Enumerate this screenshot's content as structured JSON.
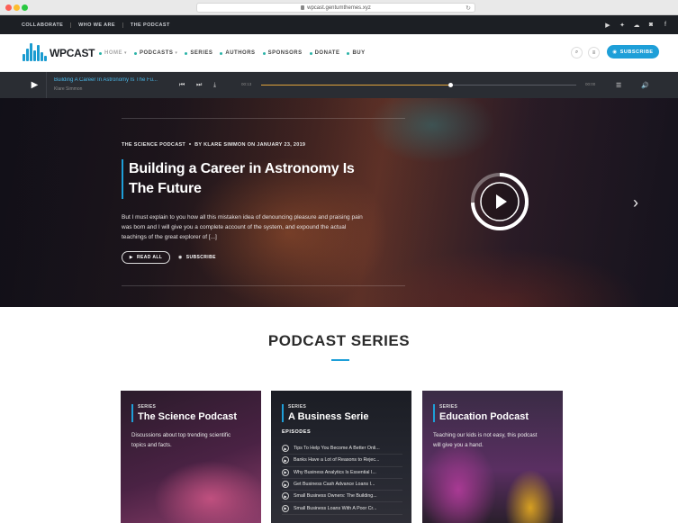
{
  "browser": {
    "url": "wpcast.gentumthemes.xyz"
  },
  "topbar": {
    "links": [
      "COLLABORATE",
      "WHO WE ARE",
      "THE PODCAST"
    ],
    "social_icons": [
      "youtube-icon",
      "twitter-icon",
      "soundcloud-icon",
      "instagram-icon",
      "facebook-icon"
    ]
  },
  "header": {
    "logo_text": "WPCAST",
    "nav": [
      {
        "label": "HOME",
        "active": true,
        "dropdown": true
      },
      {
        "label": "PODCASTS",
        "active": false,
        "dropdown": true
      },
      {
        "label": "SERIES",
        "active": false,
        "dropdown": false
      },
      {
        "label": "AUTHORS",
        "active": false,
        "dropdown": false
      },
      {
        "label": "SPONSORS",
        "active": false,
        "dropdown": false
      },
      {
        "label": "DONATE",
        "active": false,
        "dropdown": false
      },
      {
        "label": "BUY",
        "active": false,
        "dropdown": false
      }
    ],
    "subscribe_label": "SUBSCRIBE"
  },
  "player": {
    "title": "Building A Career In Astronomy Is The Fu...",
    "author": "Klare Simmon",
    "time_current": "00:13",
    "time_total": "00:00",
    "progress": 0.6
  },
  "hero": {
    "category": "THE SCIENCE PODCAST",
    "byline": "BY KLARE SIMMON ON JANUARY 23, 2019",
    "title_line1": "Building a Career in Astronomy Is",
    "title_line2": "The Future",
    "excerpt": "But I must explain to you how all this mistaken idea of denouncing pleasure and praising pain was born and I will give you a complete account of the system, and expound the actual teachings of the great explorer of [...]",
    "read_more": "READ ALL",
    "subscribe": "SUBSCRIBE"
  },
  "series_section": {
    "title": "PODCAST SERIES",
    "cards": [
      {
        "small": "SERIES",
        "name": "The Science Podcast",
        "desc": "Discussions about top trending scientific topics and facts."
      },
      {
        "small": "SERIES",
        "name": "A Business Serie",
        "episodes_label": "EPISODES",
        "episodes": [
          "Tips To Help You Become A Better Onli...",
          "Banks Have a Lot of Reasons to Rejec...",
          "Why Business Analytics Is Essential I...",
          "Get Business Cash Advance Loans I...",
          "Small Business Owners: The Building...",
          "Small Business Loans With A Poor Cr..."
        ]
      },
      {
        "small": "SERIES",
        "name": "Education Podcast",
        "desc": "Teaching our kids is not easy, this podcast will give you a hand."
      }
    ]
  },
  "colors": {
    "accent": "#1e9fd8",
    "dark": "#1c1f24",
    "progress": "#e0a33a",
    "nav_bullet": "#2bb3a8"
  }
}
